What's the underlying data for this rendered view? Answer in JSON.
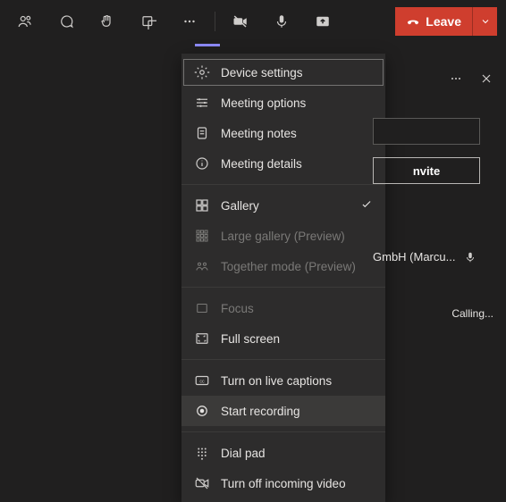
{
  "toolbar": {
    "leave_label": "Leave"
  },
  "menu": {
    "device_settings": "Device settings",
    "meeting_options": "Meeting options",
    "meeting_notes": "Meeting notes",
    "meeting_details": "Meeting details",
    "gallery": "Gallery",
    "large_gallery": "Large gallery (Preview)",
    "together_mode": "Together mode (Preview)",
    "focus": "Focus",
    "full_screen": "Full screen",
    "live_captions": "Turn on live captions",
    "start_recording": "Start recording",
    "dial_pad": "Dial pad",
    "turn_off_video": "Turn off incoming video"
  },
  "panel": {
    "invite_label": "nvite",
    "participant_text": "GmbH (Marcu...",
    "status_text": "Calling..."
  }
}
